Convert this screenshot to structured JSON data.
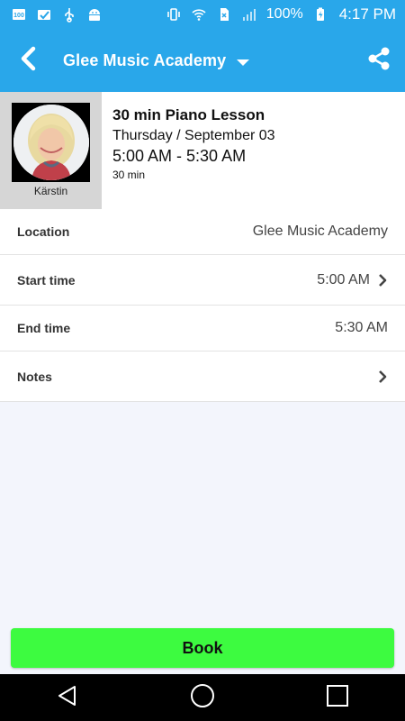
{
  "status_bar": {
    "battery": "100%",
    "time": "4:17 PM",
    "icons": [
      "notification-100-icon",
      "image-check-icon",
      "usb-icon",
      "android-icon",
      "vibrate-icon",
      "wifi-icon",
      "no-sim-icon",
      "signal-icon",
      "battery-icon"
    ]
  },
  "app_bar": {
    "title": "Glee Music Academy",
    "back_icon": "chevron-left-icon",
    "share_icon": "share-icon"
  },
  "lesson": {
    "teacher": "Kärstin",
    "title": "30 min Piano Lesson",
    "date": "Thursday / September 03",
    "time": "5:00 AM - 5:30 AM",
    "duration": "30 min"
  },
  "details": {
    "location": {
      "label": "Location",
      "value": "Glee Music Academy"
    },
    "start_time": {
      "label": "Start time",
      "value": "5:00 AM"
    },
    "end_time": {
      "label": "End time",
      "value": "5:30 AM"
    },
    "notes": {
      "label": "Notes"
    }
  },
  "book_button": "Book",
  "colors": {
    "primary": "#29a7ea",
    "book_green": "#3dfb40",
    "background": "#f3f5fc"
  }
}
